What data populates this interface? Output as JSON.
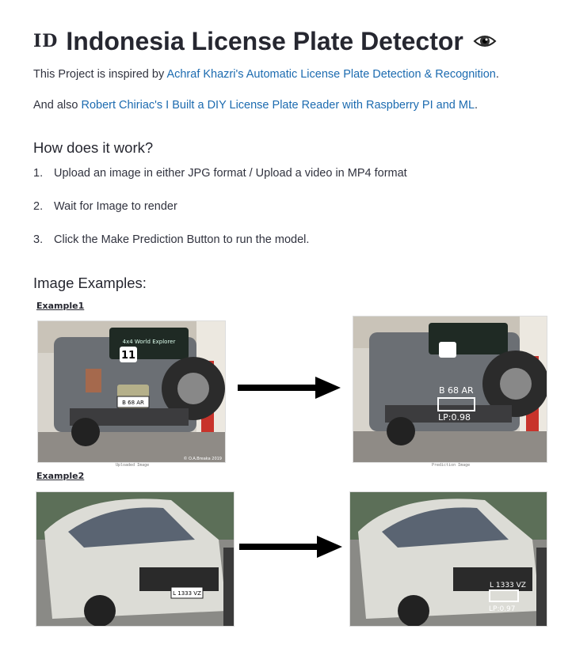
{
  "title": {
    "flag": "ID",
    "text": "Indonesia License Plate Detector",
    "icon": "eye-icon"
  },
  "intro": {
    "p1_prefix": "This Project is inspired by ",
    "p1_link": "Achraf Khazri's Automatic License Plate Detection & Recognition",
    "p1_suffix": ".",
    "p2_prefix": "And also ",
    "p2_link": "Robert Chiriac's I Built a DIY License Plate Reader with Raspberry PI and ML",
    "p2_suffix": "."
  },
  "how": {
    "heading": "How does it work?",
    "steps": [
      {
        "num": "1.",
        "text": "Upload an image in either JPG format / Upload a video in MP4 format"
      },
      {
        "num": "2.",
        "text": "Wait for Image to render"
      },
      {
        "num": "3.",
        "text": "Click the Make Prediction Button to run the model."
      }
    ]
  },
  "examples": {
    "heading": "Image Examples:",
    "ex1": {
      "label": "Example1",
      "uploaded_caption": "Uploaded Image",
      "prediction_caption": "Prediction Image",
      "watermark": "© O.A.Breaka 2019",
      "plate_text": "B 68 AR",
      "detected_text": "B 68 AR",
      "confidence": "LP:0.98",
      "banner": "4x4 World Explorer",
      "sticker": "11"
    },
    "ex2": {
      "label": "Example2",
      "plate_text": "L 1333 VZ",
      "detected_text": "L 1333 VZ",
      "confidence": "LP:0.97"
    }
  },
  "colors": {
    "link": "#1c6bb0",
    "text": "#31333f",
    "arrow": "#000000"
  }
}
